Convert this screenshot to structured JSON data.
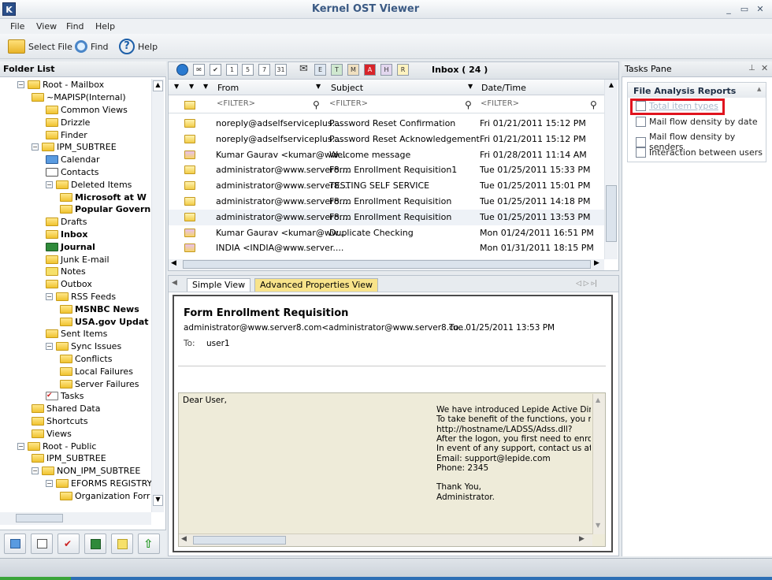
{
  "app": {
    "title": "Kernel OST Viewer",
    "icon_letter": "K"
  },
  "window_controls": {
    "minimize": "_",
    "restore": "▭",
    "close": "✕"
  },
  "menu": [
    "File",
    "View",
    "Find",
    "Help"
  ],
  "toolbar": {
    "select_file": "Select File",
    "find": "Find",
    "help": "Help"
  },
  "folder_pane": {
    "title": "Folder List",
    "items": [
      {
        "label": "Root - Mailbox",
        "bold": false
      },
      {
        "label": "~MAPISP(Internal)",
        "bold": false
      },
      {
        "label": "Common Views",
        "bold": false
      },
      {
        "label": "Drizzle",
        "bold": false
      },
      {
        "label": "Finder",
        "bold": false
      },
      {
        "label": "IPM_SUBTREE",
        "bold": false
      },
      {
        "label": "Calendar",
        "bold": false
      },
      {
        "label": "Contacts",
        "bold": false
      },
      {
        "label": "Deleted Items",
        "bold": false
      },
      {
        "label": "Microsoft at W",
        "bold": true
      },
      {
        "label": "Popular Govern",
        "bold": true
      },
      {
        "label": "Drafts",
        "bold": false
      },
      {
        "label": "Inbox",
        "bold": true
      },
      {
        "label": "Journal",
        "bold": true
      },
      {
        "label": "Junk E-mail",
        "bold": false
      },
      {
        "label": "Notes",
        "bold": false
      },
      {
        "label": "Outbox",
        "bold": false
      },
      {
        "label": "RSS Feeds",
        "bold": false
      },
      {
        "label": "MSNBC News",
        "bold": true
      },
      {
        "label": "USA.gov Updat",
        "bold": true
      },
      {
        "label": "Sent Items",
        "bold": false
      },
      {
        "label": "Sync Issues",
        "bold": false
      },
      {
        "label": "Conflicts",
        "bold": false
      },
      {
        "label": "Local Failures",
        "bold": false
      },
      {
        "label": "Server Failures",
        "bold": false
      },
      {
        "label": "Tasks",
        "bold": false
      },
      {
        "label": "Shared Data",
        "bold": false
      },
      {
        "label": "Shortcuts",
        "bold": false
      },
      {
        "label": "Views",
        "bold": false
      },
      {
        "label": "Root - Public",
        "bold": false
      },
      {
        "label": "IPM_SUBTREE",
        "bold": false
      },
      {
        "label": "NON_IPM_SUBTREE",
        "bold": false
      },
      {
        "label": "EFORMS REGISTRY",
        "bold": false
      },
      {
        "label": "Organization Forr",
        "bold": false
      }
    ]
  },
  "message_list": {
    "folder_label": "Inbox ( 24 )",
    "columns": {
      "from": "From",
      "subject": "Subject",
      "date": "Date/Time"
    },
    "filter_placeholder": "<FILTER>",
    "rows": [
      {
        "from": "noreply@adselfserviceplus....",
        "subject": "Password Reset Confirmation",
        "date": "Fri 01/21/2011 15:12 PM",
        "icon": "closed"
      },
      {
        "from": "noreply@adselfserviceplus....",
        "subject": "Password Reset Acknowledgement",
        "date": "Fri 01/21/2011 15:12 PM",
        "icon": "closed"
      },
      {
        "from": "Kumar Gaurav <kumar@ww...",
        "subject": "Welcome message",
        "date": "Fri 01/28/2011 11:14 AM",
        "icon": "open"
      },
      {
        "from": "administrator@www.server8....",
        "subject": "Form Enrollment Requisition1",
        "date": "Tue 01/25/2011 15:33 PM",
        "icon": "closed"
      },
      {
        "from": "administrator@www.server8....",
        "subject": "TESTING SELF SERVICE",
        "date": "Tue 01/25/2011 15:01 PM",
        "icon": "closed"
      },
      {
        "from": "administrator@www.server8....",
        "subject": "Form Enrollment Requisition",
        "date": "Tue 01/25/2011 14:18 PM",
        "icon": "closed"
      },
      {
        "from": "administrator@www.server8....",
        "subject": "Form Enrollment Requisition",
        "date": "Tue 01/25/2011 13:53 PM",
        "icon": "closed"
      },
      {
        "from": "Kumar Gaurav <kumar@ww...",
        "subject": "Duplicate Checking",
        "date": "Mon 01/24/2011 16:51 PM",
        "icon": "open"
      },
      {
        "from": "INDIA <INDIA@www.server....",
        "subject": "",
        "date": "Mon 01/31/2011 18:15 PM",
        "icon": "open"
      }
    ]
  },
  "preview": {
    "tabs": [
      "Simple View",
      "Advanced Properties View"
    ],
    "subject": "Form Enrollment Requisition",
    "sender": "administrator@www.server8.com<administrator@www.server8.co...",
    "sent": "Tue 01/25/2011 13:53 PM",
    "to_label": "To:",
    "to": "user1",
    "greeting": "Dear User,",
    "body_lines": [
      "We have introduced Lepide Active Direc",
      "To take benefit of the functions, you ne",
      "http://hostname/LADSS/Adss.dll?",
      "After the logon, you first need to enroll",
      "In event of any support, contact us at tl",
      "Email: support@lepide.com",
      "Phone: 2345",
      "",
      "Thank You,",
      "Administrator."
    ]
  },
  "tasks_pane": {
    "title": "Tasks Pane",
    "group_title": "File Analysis Reports",
    "items": [
      "Total item types",
      "Mail flow density by date",
      "Mail flow density by senders",
      "Interaction between users"
    ],
    "highlight_color": "#e0141e"
  }
}
